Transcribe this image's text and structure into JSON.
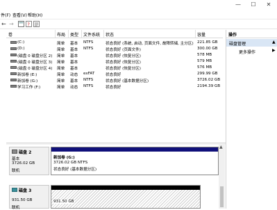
{
  "window": {
    "minimize": "—",
    "maximize": "☐",
    "close": "✕"
  },
  "menu": {
    "items": [
      "件(F)",
      "查看(V)",
      "帮助(H)"
    ]
  },
  "toolbar": {
    "icons": [
      "back-icon",
      "forward-icon",
      "view-icon",
      "help-icon",
      "properties-icon",
      "refresh-icon"
    ]
  },
  "table": {
    "headers": [
      "卷",
      "布局",
      "类型",
      "文件系统",
      "状态",
      "容量"
    ],
    "rows": [
      {
        "name": "(C:)",
        "layout": "简单",
        "type": "基本",
        "fs": "NTFS",
        "status": "状态良好 (系统, 启动, 页面文件, 故障转储, 主分区)",
        "capacity": "221.85 GB"
      },
      {
        "name": "(D:)",
        "layout": "简单",
        "type": "基本",
        "fs": "NTFS",
        "status": "状态良好 (页面文件)",
        "capacity": "300.00 GB"
      },
      {
        "name": "(磁盘 0 磁盘分区 2)",
        "layout": "简单",
        "type": "基本",
        "fs": "",
        "status": "状态良好 (恢复分区)",
        "capacity": "578 MB"
      },
      {
        "name": "(磁盘 0 磁盘分区 3)",
        "layout": "简单",
        "type": "基本",
        "fs": "",
        "status": "状态良好 (恢复分区)",
        "capacity": "579 MB"
      },
      {
        "name": "(磁盘 0 磁盘分区 4)",
        "layout": "简单",
        "type": "基本",
        "fs": "",
        "status": "状态良好 (恢复分区)",
        "capacity": "576 MB"
      },
      {
        "name": "新加卷 (E:)",
        "layout": "简单",
        "type": "动态",
        "fs": "exFAT",
        "status": "状态良好",
        "capacity": "299.99 GB"
      },
      {
        "name": "新加卷 (G:)",
        "layout": "简单",
        "type": "基本",
        "fs": "NTFS",
        "status": "状态良好 (基本数据分区)",
        "capacity": "3726.02 GB"
      },
      {
        "name": "学习工作 (F:)",
        "layout": "简单",
        "type": "动态",
        "fs": "NTFS",
        "status": "状态良好",
        "capacity": "2194.39 GB"
      }
    ]
  },
  "disks": [
    {
      "name": "磁盘 2",
      "type": "基本",
      "size": "3726.02 GB",
      "state": "联机",
      "volume": {
        "name": "新加卷 (G:)",
        "size": "3726.02 GB NTFS",
        "status": "状态良好 (基本数据分区)"
      }
    },
    {
      "name": "磁盘 3",
      "type": "",
      "size": "931.50 GB",
      "state": "联机",
      "volume": {
        "size": "931.50 GB"
      }
    }
  ],
  "operations": {
    "title": "操作",
    "section": "磁盘管理",
    "more": "更多操作"
  },
  "colors": {
    "primary_bar": "#10107a",
    "dark_bar": "#000000",
    "selection": "#d9e6f5"
  }
}
